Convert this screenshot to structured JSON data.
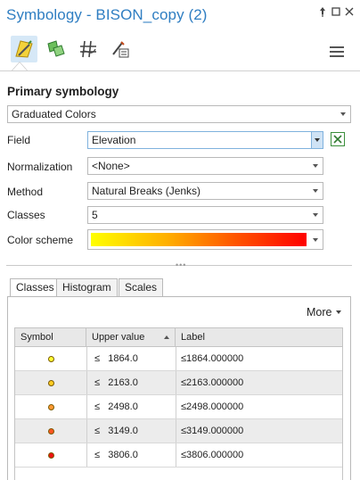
{
  "window": {
    "title": "Symbology - BISON_copy (2)",
    "controls": [
      "pin-icon",
      "maximize-icon",
      "close-icon"
    ]
  },
  "toolbar": {
    "tools": [
      {
        "name": "primary-symbology-icon",
        "active": true
      },
      {
        "name": "vary-symbology-icon",
        "active": false
      },
      {
        "name": "symbol-layer-drawing-icon",
        "active": false
      },
      {
        "name": "label-classes-icon",
        "active": false
      }
    ],
    "menu_icon": "hamburger-menu-icon"
  },
  "primary": {
    "heading": "Primary symbology",
    "renderer": "Graduated Colors"
  },
  "form": {
    "field_label": "Field",
    "field_value": "Elevation",
    "normalization_label": "Normalization",
    "normalization_value": "<None>",
    "method_label": "Method",
    "method_value": "Natural Breaks (Jenks)",
    "classes_label": "Classes",
    "classes_value": "5",
    "color_scheme_label": "Color scheme",
    "color_scheme_colors": [
      "#ffff00",
      "#ffb000",
      "#ff5a00",
      "#ff0000"
    ]
  },
  "tabs": [
    {
      "label": "Classes",
      "active": true
    },
    {
      "label": "Histogram",
      "active": false
    },
    {
      "label": "Scales",
      "active": false
    }
  ],
  "more_label": "More",
  "table": {
    "columns": [
      "Symbol",
      "Upper value",
      "Label"
    ],
    "rows": [
      {
        "symbol_color": "#ffff33",
        "upper": "≤   1864.0",
        "label": "≤1864.000000"
      },
      {
        "symbol_color": "#ffcc22",
        "upper": "≤   2163.0",
        "label": "≤2163.000000"
      },
      {
        "symbol_color": "#ff9933",
        "upper": "≤   2498.0",
        "label": "≤2498.000000"
      },
      {
        "symbol_color": "#ff5522",
        "upper": "≤   3149.0",
        "label": "≤3149.000000"
      },
      {
        "symbol_color": "#ee1111",
        "upper": "≤   3806.0",
        "label": "≤3806.000000"
      }
    ]
  },
  "colors": {
    "title_blue": "#2f7ec2",
    "active_tool_bg": "#d6e8f7"
  }
}
